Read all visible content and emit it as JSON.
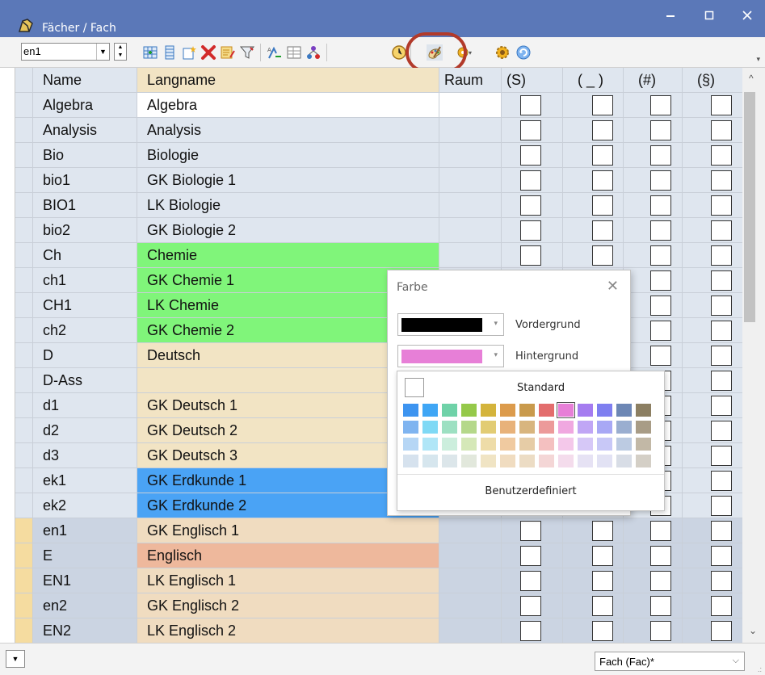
{
  "window": {
    "title": "Fächer / Fach"
  },
  "toolbar": {
    "combo_value": "en1",
    "icons": [
      "grid-add-icon",
      "list-icon",
      "new-record-icon",
      "delete-x-icon",
      "edit-list-icon",
      "filter-icon",
      "sort-icon",
      "table-icon",
      "tree-icon",
      "clock-icon",
      "color-palette-icon",
      "settings-dropdown-icon",
      "gear-icon",
      "refresh-icon"
    ]
  },
  "table": {
    "headers": {
      "name": "Name",
      "langname": "Langname",
      "raum": "Raum",
      "s": "(S)",
      "u": "( _ )",
      "h": "(#)",
      "p": "(§)"
    },
    "rows": [
      {
        "name": "Algebra",
        "langname": "Algebra",
        "bg": "#ffffff",
        "indicator": "#dfe6ef"
      },
      {
        "name": "Analysis",
        "langname": "Analysis",
        "bg": "#dfe6ef",
        "indicator": "#dfe6ef"
      },
      {
        "name": "Bio",
        "langname": "Biologie",
        "bg": "#dfe6ef",
        "indicator": "#dfe6ef"
      },
      {
        "name": "bio1",
        "langname": "GK Biologie 1",
        "bg": "#dfe6ef",
        "indicator": "#dfe6ef"
      },
      {
        "name": "BIO1",
        "langname": "LK Biologie",
        "bg": "#dfe6ef",
        "indicator": "#dfe6ef"
      },
      {
        "name": "bio2",
        "langname": "GK Biologie 2",
        "bg": "#dfe6ef",
        "indicator": "#dfe6ef"
      },
      {
        "name": "Ch",
        "langname": "Chemie",
        "bg": "#80f57a",
        "indicator": "#dfe6ef"
      },
      {
        "name": "ch1",
        "langname": "GK Chemie 1",
        "bg": "#80f57a",
        "indicator": "#dfe6ef"
      },
      {
        "name": "CH1",
        "langname": "LK Chemie",
        "bg": "#80f57a",
        "indicator": "#dfe6ef"
      },
      {
        "name": "ch2",
        "langname": "GK Chemie 2",
        "bg": "#80f57a",
        "indicator": "#dfe6ef"
      },
      {
        "name": "D",
        "langname": "Deutsch",
        "bg": "#f2e4c4",
        "indicator": "#dfe6ef"
      },
      {
        "name": "D-Ass",
        "langname": "",
        "bg": "#f2e4c4",
        "indicator": "#dfe6ef"
      },
      {
        "name": "d1",
        "langname": "GK Deutsch 1",
        "bg": "#f2e4c4",
        "indicator": "#dfe6ef"
      },
      {
        "name": "d2",
        "langname": "GK Deutsch 2",
        "bg": "#f2e4c4",
        "indicator": "#dfe6ef"
      },
      {
        "name": "d3",
        "langname": "GK Deutsch 3",
        "bg": "#f2e4c4",
        "indicator": "#dfe6ef"
      },
      {
        "name": "ek1",
        "langname": "GK Erdkunde 1",
        "bg": "#4aa3f5",
        "indicator": "#dfe6ef"
      },
      {
        "name": "ek2",
        "langname": "GK Erdkunde 2",
        "bg": "#4aa3f5",
        "indicator": "#dfe6ef"
      },
      {
        "name": "en1",
        "langname": "GK Englisch 1",
        "bg": "#f0dcc0",
        "indicator": "#f5dca0",
        "selected": true
      },
      {
        "name": "E",
        "langname": "Englisch",
        "bg": "#eeb89c",
        "indicator": "#f5dca0",
        "selected": true
      },
      {
        "name": "EN1",
        "langname": "LK Englisch 1",
        "bg": "#f0dcc0",
        "indicator": "#f5dca0",
        "selected": true
      },
      {
        "name": "en2",
        "langname": "GK Englisch 2",
        "bg": "#f0dcc0",
        "indicator": "#f5dca0",
        "selected": true
      },
      {
        "name": "EN2",
        "langname": "LK Englisch 2",
        "bg": "#f0dcc0",
        "indicator": "#f5dca0",
        "selected": true
      }
    ]
  },
  "color_dialog": {
    "title": "Farbe",
    "foreground_label": "Vordergrund",
    "foreground_color": "#000000",
    "background_label": "Hintergrund",
    "background_color": "#e77fd7"
  },
  "palette": {
    "standard_label": "Standard",
    "custom_label": "Benutzerdefiniert",
    "selected_color": "#e77fd7",
    "colors": [
      [
        "#3d94f0",
        "#3fa6f5",
        "#6fd2a8",
        "#95c94a",
        "#d4b43c",
        "#dc9b4c",
        "#c99a4c",
        "#e36d6d",
        "#e77fd7",
        "#a57cf0",
        "#7f7ff0",
        "#6d87b5",
        "#8c7f62"
      ],
      [
        "#7fb4f0",
        "#7fd9f5",
        "#9de0c2",
        "#b5d88a",
        "#e2cc74",
        "#e8b27a",
        "#d8b57e",
        "#ec9a9a",
        "#f0a8e0",
        "#c0a6f5",
        "#a8a8f5",
        "#9aaed0",
        "#a89c86"
      ],
      [
        "#b6d6f5",
        "#b0e6f7",
        "#cceedd",
        "#d5e8b8",
        "#eedca8",
        "#f0caa0",
        "#e6cca6",
        "#f4c0c0",
        "#f4c8ea",
        "#d6c8f7",
        "#c8c8f7",
        "#bccbe2",
        "#c2b8a6"
      ],
      [
        "#d6e2ee",
        "#d6e6ee",
        "#dce6ea",
        "#e2e8dc",
        "#f0e4c4",
        "#f0dcc0",
        "#ecdcc4",
        "#f4d6d6",
        "#f4dcec",
        "#e6e2f4",
        "#e2e2f4",
        "#d8dde6",
        "#d4cfc6"
      ]
    ]
  },
  "statusbar": {
    "view_value": "Fach (Fac)*"
  }
}
